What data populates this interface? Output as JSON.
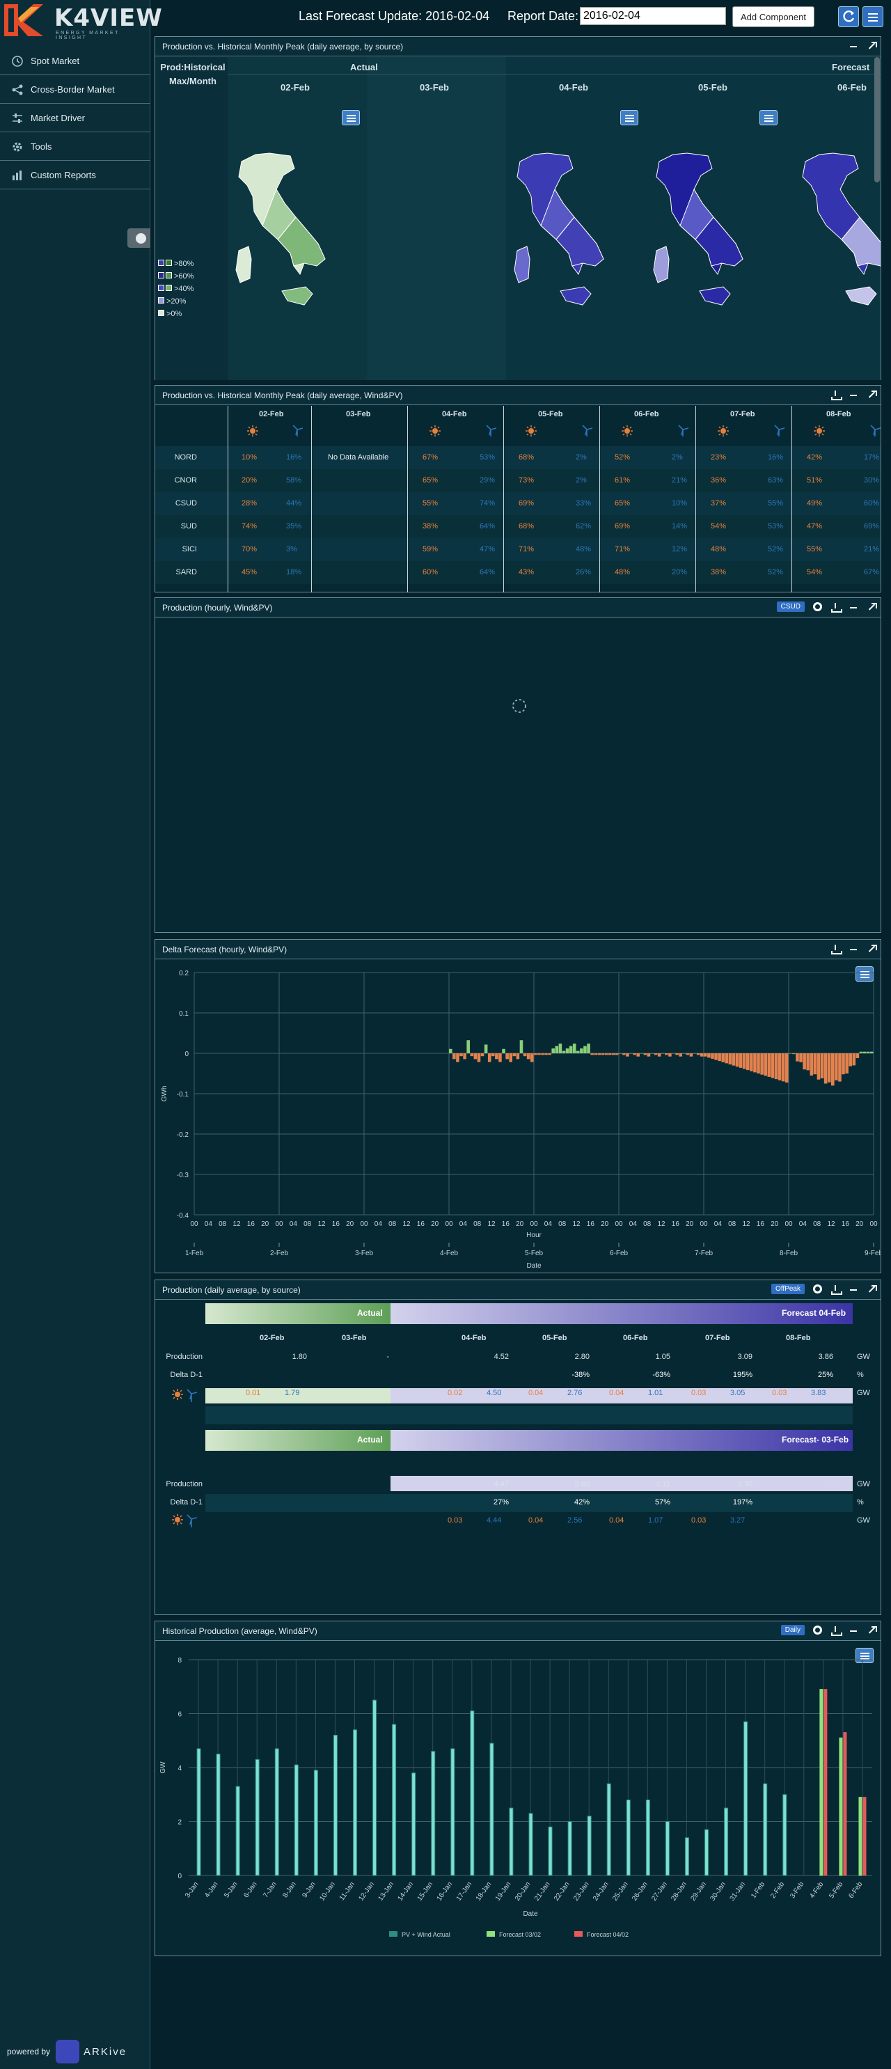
{
  "app": {
    "logo": "K4VIEW",
    "tagline": "ENERGY MARKET INSIGHT",
    "powered_by": "powered by",
    "arkive": "ARKive"
  },
  "nav": [
    {
      "label": "Spot Market",
      "icon": "clock-icon"
    },
    {
      "label": "Cross-Border Market",
      "icon": "share-icon"
    },
    {
      "label": "Market Driver",
      "icon": "sliders-icon"
    },
    {
      "label": "Tools",
      "icon": "gear-icon"
    },
    {
      "label": "Custom Reports",
      "icon": "bar-chart-icon"
    }
  ],
  "topbar": {
    "last_update": "Last Forecast Update: 2016-02-04",
    "report_label": "Report Date:",
    "report_date": "2016-02-04",
    "add_component": "Add Component"
  },
  "panel1": {
    "title": "Production vs. Historical Monthly Peak (daily average, by source)",
    "corner": "Prod:Historical Max/Month",
    "actual": "Actual",
    "forecast": "Forecast",
    "dates": [
      "02-Feb",
      "03-Feb",
      "04-Feb",
      "05-Feb",
      "06-Feb"
    ],
    "legend": [
      ">80%",
      ">60%",
      ">40%",
      ">20%",
      ">0%"
    ]
  },
  "panel2": {
    "title": "Production vs. Historical Monthly Peak (daily average, Wind&PV)",
    "dates": [
      "02-Feb",
      "03-Feb",
      "04-Feb",
      "05-Feb",
      "06-Feb",
      "07-Feb",
      "08-Feb"
    ],
    "no_data": "No Data Available",
    "rows": [
      {
        "zone": "NORD",
        "vals": [
          [
            "10%",
            "16%"
          ],
          null,
          [
            "67%",
            "53%"
          ],
          [
            "68%",
            "2%"
          ],
          [
            "52%",
            "2%"
          ],
          [
            "23%",
            "16%"
          ],
          [
            "42%",
            "17%"
          ]
        ]
      },
      {
        "zone": "CNOR",
        "vals": [
          [
            "20%",
            "58%"
          ],
          null,
          [
            "65%",
            "29%"
          ],
          [
            "73%",
            "2%"
          ],
          [
            "61%",
            "21%"
          ],
          [
            "36%",
            "63%"
          ],
          [
            "51%",
            "30%"
          ]
        ]
      },
      {
        "zone": "CSUD",
        "vals": [
          [
            "28%",
            "44%"
          ],
          null,
          [
            "55%",
            "74%"
          ],
          [
            "69%",
            "33%"
          ],
          [
            "65%",
            "10%"
          ],
          [
            "37%",
            "55%"
          ],
          [
            "49%",
            "60%"
          ]
        ]
      },
      {
        "zone": "SUD",
        "vals": [
          [
            "74%",
            "35%"
          ],
          null,
          [
            "38%",
            "64%"
          ],
          [
            "68%",
            "62%"
          ],
          [
            "69%",
            "14%"
          ],
          [
            "54%",
            "53%"
          ],
          [
            "47%",
            "69%"
          ]
        ]
      },
      {
        "zone": "SICI",
        "vals": [
          [
            "70%",
            "3%"
          ],
          null,
          [
            "59%",
            "47%"
          ],
          [
            "71%",
            "48%"
          ],
          [
            "71%",
            "12%"
          ],
          [
            "48%",
            "52%"
          ],
          [
            "55%",
            "21%"
          ]
        ]
      },
      {
        "zone": "SARD",
        "vals": [
          [
            "45%",
            "18%"
          ],
          null,
          [
            "60%",
            "64%"
          ],
          [
            "43%",
            "26%"
          ],
          [
            "48%",
            "20%"
          ],
          [
            "38%",
            "52%"
          ],
          [
            "54%",
            "67%"
          ]
        ]
      }
    ]
  },
  "panel3": {
    "title": "Production (hourly, Wind&PV)",
    "zone": "CSUD"
  },
  "panel4": {
    "title": "Delta Forecast (hourly, Wind&PV)",
    "ylabel": "GWh",
    "xlabel": "Hour",
    "xlabel2": "Date",
    "yticks": [
      "0.2",
      "0.1",
      "0",
      "-0.1",
      "-0.2",
      "-0.3",
      "-0.4"
    ],
    "hour_ticks": [
      "00",
      "04",
      "08",
      "12",
      "16",
      "20"
    ],
    "date_ticks": [
      "1-Feb",
      "2-Feb",
      "3-Feb",
      "4-Feb",
      "5-Feb",
      "6-Feb",
      "7-Feb",
      "8-Feb",
      "9-Feb"
    ]
  },
  "panel5": {
    "title": "Production (daily average, by source)",
    "mode": "OffPeak",
    "actual": "Actual",
    "forecast1": "Forecast 04-Feb",
    "forecast2": "Forecast- 03-Feb",
    "dates": [
      "02-Feb",
      "03-Feb",
      "04-Feb",
      "05-Feb",
      "06-Feb",
      "07-Feb",
      "08-Feb"
    ],
    "prod_label": "Production",
    "delta_label": "Delta D-1",
    "gw": "GW",
    "pct": "%",
    "prod1": [
      "1.80",
      "-",
      "4.52",
      "2.80",
      "1.05",
      "3.09",
      "3.86"
    ],
    "delta1": [
      "",
      "",
      "",
      "-38%",
      "-63%",
      "195%",
      "25%"
    ],
    "src1": [
      [
        "0.01",
        "1.79"
      ],
      [
        "",
        ""
      ],
      [
        "0.02",
        "4.50"
      ],
      [
        "0.04",
        "2.76"
      ],
      [
        "0.04",
        "1.01"
      ],
      [
        "0.03",
        "3.05"
      ],
      [
        "0.03",
        "3.83"
      ]
    ],
    "prod2": [
      "",
      "",
      "4.47",
      "2.60",
      "1.11",
      "3.30",
      "-"
    ],
    "delta2": [
      "",
      "",
      "27%",
      "42%",
      "57%",
      "197%",
      ""
    ],
    "src2": [
      [
        "",
        ""
      ],
      [
        "",
        ""
      ],
      [
        "0.03",
        "4.44"
      ],
      [
        "0.04",
        "2.56"
      ],
      [
        "0.04",
        "1.07"
      ],
      [
        "0.03",
        "3.27"
      ],
      [
        "",
        ""
      ]
    ]
  },
  "panel6": {
    "title": "Historical Production (average, Wind&PV)",
    "mode": "Daily",
    "ylabel": "GW",
    "xlabel": "Date",
    "yticks": [
      "8",
      "6",
      "4",
      "2",
      "0"
    ],
    "legend": [
      "PV + Wind Actual",
      "Forecast 03/02",
      "Forecast 04/02"
    ],
    "colors": {
      "actual": "#2f8c86",
      "f03": "#8fe27c",
      "f04": "#e65a5a"
    },
    "chart_data": {
      "type": "bar",
      "categories": [
        "3-Jan",
        "4-Jan",
        "5-Jan",
        "6-Jan",
        "7-Jan",
        "8-Jan",
        "9-Jan",
        "10-Jan",
        "11-Jan",
        "12-Jan",
        "13-Jan",
        "14-Jan",
        "15-Jan",
        "16-Jan",
        "17-Jan",
        "18-Jan",
        "19-Jan",
        "20-Jan",
        "21-Jan",
        "22-Jan",
        "23-Jan",
        "24-Jan",
        "25-Jan",
        "26-Jan",
        "27-Jan",
        "28-Jan",
        "29-Jan",
        "30-Jan",
        "31-Jan",
        "1-Feb",
        "2-Feb",
        "3-Feb",
        "4-Feb",
        "5-Feb",
        "6-Feb"
      ],
      "series": [
        {
          "name": "PV + Wind Actual",
          "values": [
            4.7,
            4.5,
            3.3,
            4.3,
            4.7,
            4.1,
            3.9,
            5.2,
            5.4,
            6.5,
            5.6,
            3.8,
            4.6,
            4.7,
            6.1,
            4.9,
            2.5,
            2.3,
            1.8,
            2.0,
            2.2,
            3.4,
            2.8,
            2.8,
            2.0,
            1.4,
            1.7,
            2.5,
            5.7,
            3.4,
            3.0,
            null,
            null,
            null,
            null
          ]
        },
        {
          "name": "Forecast 03/02",
          "values": [
            null,
            null,
            null,
            null,
            null,
            null,
            null,
            null,
            null,
            null,
            null,
            null,
            null,
            null,
            null,
            null,
            null,
            null,
            null,
            null,
            null,
            null,
            null,
            null,
            null,
            null,
            null,
            null,
            null,
            null,
            null,
            null,
            6.9,
            5.1,
            2.9
          ]
        },
        {
          "name": "Forecast 04/02",
          "values": [
            null,
            null,
            null,
            null,
            null,
            null,
            null,
            null,
            null,
            null,
            null,
            null,
            null,
            null,
            null,
            null,
            null,
            null,
            null,
            null,
            null,
            null,
            null,
            null,
            null,
            null,
            null,
            null,
            null,
            null,
            null,
            null,
            6.9,
            5.3,
            2.9
          ]
        }
      ],
      "ylabel": "GW",
      "xlabel": "Date",
      "ylim": [
        0,
        8
      ]
    }
  }
}
